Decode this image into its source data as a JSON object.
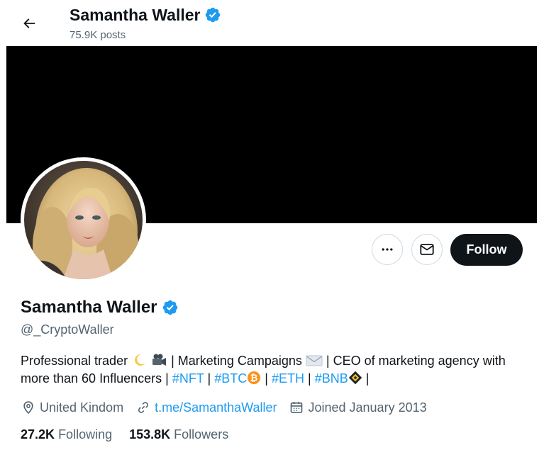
{
  "header": {
    "name": "Samantha Waller",
    "posts": "75.9K posts"
  },
  "profile": {
    "display_name": "Samantha Waller",
    "handle": "@_CryptoWaller",
    "bio": {
      "t1": "Professional trader",
      "t2": "| Marketing Campaigns",
      "t3": "| CEO of marketing agency with more than 60 Influencers |",
      "tag_nft": "#NFT",
      "sep1": "|",
      "tag_btc": "#BTC",
      "sep2": "|",
      "tag_eth": "#ETH",
      "sep3": "|",
      "tag_bnb": "#BNB",
      "sep4": "|"
    },
    "location": "United Kindom",
    "website": "t.me/SamanthaWaller",
    "joined": "Joined January 2013",
    "following_count": "27.2K",
    "following_label": "Following",
    "followers_count": "153.8K",
    "followers_label": "Followers"
  },
  "actions": {
    "follow_label": "Follow"
  },
  "colors": {
    "accent": "#1d9bf0",
    "text": "#0f1419",
    "muted": "#536471",
    "banner": "#000000",
    "bitcoin": "#f7931a",
    "bnb": "#f3ba2f"
  },
  "icons": [
    "back-arrow-icon",
    "verified-badge-icon",
    "more-icon",
    "mail-icon",
    "location-icon",
    "link-icon",
    "calendar-icon",
    "crescent-moon-icon",
    "movie-camera-icon",
    "envelope-icon",
    "bitcoin-icon",
    "bnb-icon"
  ]
}
